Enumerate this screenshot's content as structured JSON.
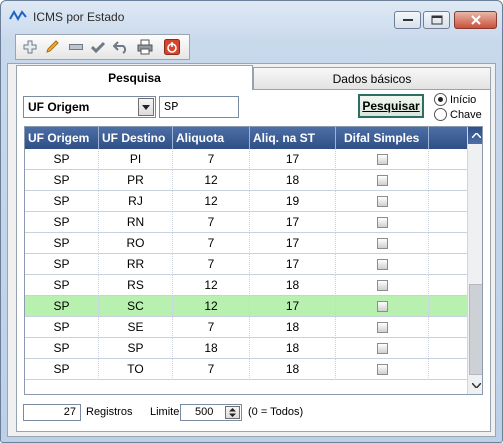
{
  "window": {
    "title": "ICMS por Estado"
  },
  "toolbar": {
    "icons": [
      "add-icon",
      "edit-pencil-icon",
      "remove-icon",
      "confirm-check-icon",
      "undo-icon",
      "print-icon",
      "power-exit-icon"
    ]
  },
  "tabs": [
    {
      "label": "Pesquisa",
      "active": true
    },
    {
      "label": "Dados básicos",
      "active": false
    }
  ],
  "search": {
    "field_selected": "UF Origem",
    "value": "SP",
    "button_label": "Pesquisar",
    "radio_options": [
      {
        "label": "Início",
        "checked": true
      },
      {
        "label": "Chave",
        "checked": false
      }
    ]
  },
  "grid": {
    "columns": [
      "UF Origem",
      "UF Destino",
      "Aliquota",
      "Aliq. na ST",
      "Difal Simples"
    ],
    "rows": [
      {
        "origem": "SP",
        "destino": "PI",
        "aliquota": "7",
        "aliq_st": "17",
        "difal": false,
        "selected": false
      },
      {
        "origem": "SP",
        "destino": "PR",
        "aliquota": "12",
        "aliq_st": "18",
        "difal": false,
        "selected": false
      },
      {
        "origem": "SP",
        "destino": "RJ",
        "aliquota": "12",
        "aliq_st": "19",
        "difal": false,
        "selected": false
      },
      {
        "origem": "SP",
        "destino": "RN",
        "aliquota": "7",
        "aliq_st": "17",
        "difal": false,
        "selected": false
      },
      {
        "origem": "SP",
        "destino": "RO",
        "aliquota": "7",
        "aliq_st": "17",
        "difal": false,
        "selected": false
      },
      {
        "origem": "SP",
        "destino": "RR",
        "aliquota": "7",
        "aliq_st": "17",
        "difal": false,
        "selected": false
      },
      {
        "origem": "SP",
        "destino": "RS",
        "aliquota": "12",
        "aliq_st": "18",
        "difal": false,
        "selected": false
      },
      {
        "origem": "SP",
        "destino": "SC",
        "aliquota": "12",
        "aliq_st": "17",
        "difal": false,
        "selected": true
      },
      {
        "origem": "SP",
        "destino": "SE",
        "aliquota": "7",
        "aliq_st": "18",
        "difal": false,
        "selected": false
      },
      {
        "origem": "SP",
        "destino": "SP",
        "aliquota": "18",
        "aliq_st": "18",
        "difal": false,
        "selected": false
      },
      {
        "origem": "SP",
        "destino": "TO",
        "aliquota": "7",
        "aliq_st": "18",
        "difal": false,
        "selected": false
      }
    ]
  },
  "footer": {
    "count": "27",
    "count_label": "Registros",
    "limit_label": "Limite:",
    "limit_value": "500",
    "limit_hint": "(0 = Todos)"
  },
  "colors": {
    "header_bg": "#2f4f85",
    "selected_row": "#b8f0b0",
    "search_button_border": "#2d6f63"
  }
}
